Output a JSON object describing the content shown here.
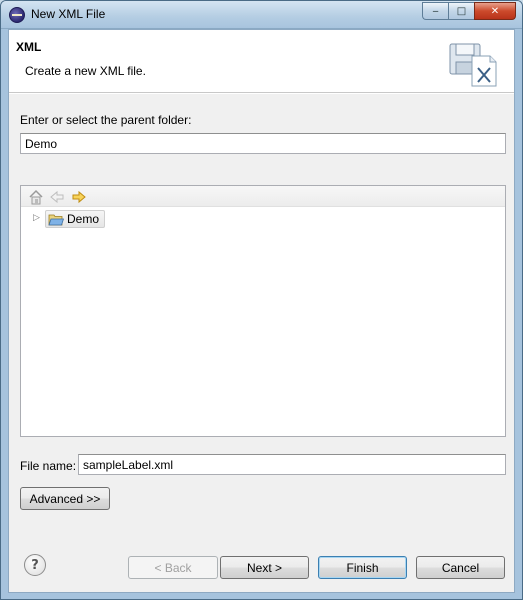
{
  "window": {
    "title": "New XML File",
    "minimize_glyph": "‒",
    "maximize_glyph": "□",
    "close_glyph": "✕"
  },
  "header": {
    "title": "XML",
    "description": "Create a new XML file."
  },
  "parent_folder": {
    "label": "Enter or select the parent folder:",
    "value": "Demo"
  },
  "tree": {
    "toolbar_icons": [
      "home-icon",
      "back-arrow-icon",
      "forward-arrow-icon"
    ],
    "items": [
      {
        "label": "Demo",
        "icon": "open-folder-icon",
        "expanded": false,
        "selected": true
      }
    ]
  },
  "file_name": {
    "label": "File name:",
    "value": "sampleLabel.xml"
  },
  "buttons": {
    "advanced": "Advanced >>",
    "back": "< Back",
    "next": "Next >",
    "finish": "Finish",
    "cancel": "Cancel",
    "help_glyph": "?"
  },
  "colors": {
    "title_bar": "#b4cde3",
    "dialog_bg": "#f0f0f0",
    "default_button_border": "#3c7fb1",
    "close_button": "#cc4a2c"
  }
}
